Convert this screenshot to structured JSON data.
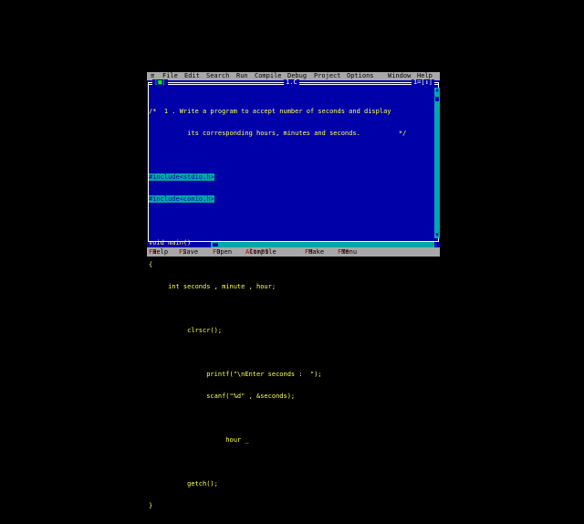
{
  "menu": {
    "system": "≡",
    "items": [
      "File",
      "Edit",
      "Search",
      "Run",
      "Compile",
      "Debug",
      "Project",
      "Options",
      "Window",
      "Help"
    ]
  },
  "window": {
    "close_box": "[■]",
    "filename": "1.C",
    "number": "1=[↕]"
  },
  "code_lines": [
    "/*  1 . Write a program to accept number of seconds and display",
    "          its corresponding hours, minutes and seconds.          */",
    "",
    "#include<stdio.h>",
    "#include<conio.h>",
    "",
    "void main()",
    "{",
    "     int seconds , minute , hour;",
    "",
    "          clrscr();",
    "",
    "               printf(\"\\nEnter seconds :  \");",
    "               scanf(\"%d\" , &seconds);",
    "",
    "                    hour _",
    "",
    "          getch();",
    "}"
  ],
  "status": {
    "cursor_pos": "17:22"
  },
  "function_keys": [
    {
      "key": "F1",
      "label": "Help"
    },
    {
      "key": "F2",
      "label": "Save"
    },
    {
      "key": "F3",
      "label": "Open"
    },
    {
      "key": "Alt-F9",
      "label": "Compile"
    },
    {
      "key": "F9",
      "label": "Make"
    },
    {
      "key": "F10",
      "label": "Menu"
    }
  ],
  "colors": {
    "background": "#0000a8",
    "text": "#ffff55",
    "menu_bg": "#a8a8a8",
    "hotkey": "#a80000",
    "selection": "#00a8a8"
  }
}
